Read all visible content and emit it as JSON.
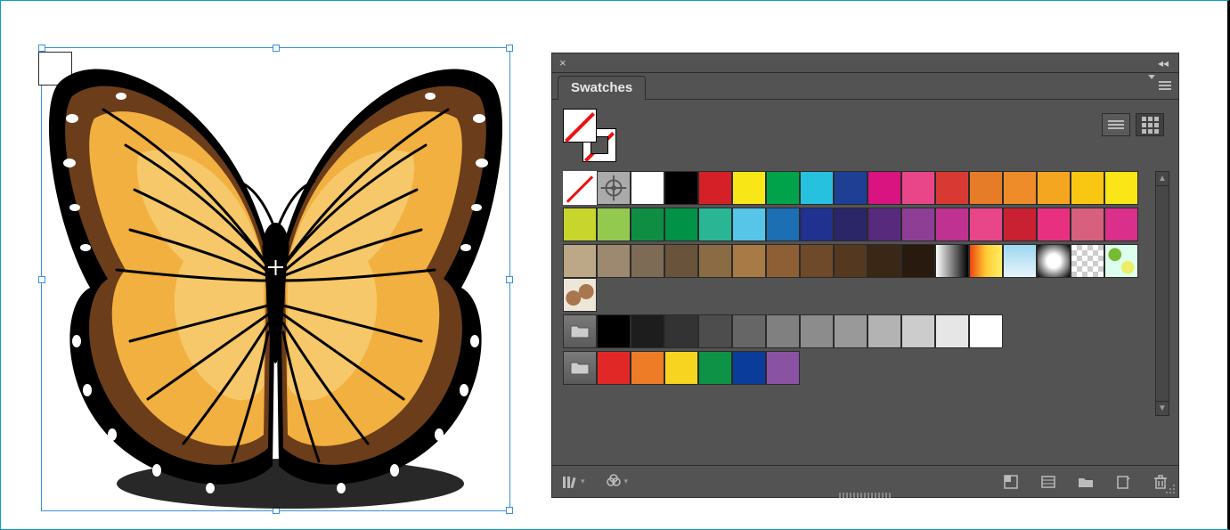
{
  "panel": {
    "tab_label": "Swatches",
    "view_mode": "grid"
  },
  "fill_stroke": {
    "fill": "none",
    "stroke": "none"
  },
  "view_buttons": {
    "list_tooltip": "List View",
    "grid_tooltip": "Thumbnail View"
  },
  "swatch_rows": {
    "row1": [
      {
        "name": "none",
        "kind": "none",
        "selected": true
      },
      {
        "name": "registration",
        "kind": "reg"
      },
      {
        "name": "white",
        "color": "#ffffff"
      },
      {
        "name": "black",
        "color": "#000000"
      },
      {
        "name": "red",
        "color": "#d62027"
      },
      {
        "name": "yellow",
        "color": "#f9e616"
      },
      {
        "name": "green",
        "color": "#00a34a"
      },
      {
        "name": "cyan",
        "color": "#27c1e0"
      },
      {
        "name": "blue",
        "color": "#1f3f94"
      },
      {
        "name": "magenta",
        "color": "#d9137f"
      },
      {
        "name": "rose",
        "color": "#e9468a"
      },
      {
        "name": "red2",
        "color": "#d83a33"
      },
      {
        "name": "orange",
        "color": "#e77c28"
      },
      {
        "name": "orange2",
        "color": "#ee8c2a"
      },
      {
        "name": "amber",
        "color": "#f4a620"
      },
      {
        "name": "gold",
        "color": "#f9c712"
      },
      {
        "name": "yellow2",
        "color": "#fae516"
      }
    ],
    "row2": [
      {
        "name": "chartreuse",
        "color": "#c7d52c"
      },
      {
        "name": "lime",
        "color": "#94c950"
      },
      {
        "name": "green2",
        "color": "#0f8e43"
      },
      {
        "name": "green3",
        "color": "#009247"
      },
      {
        "name": "teal",
        "color": "#2ab694"
      },
      {
        "name": "sky",
        "color": "#56c5e8"
      },
      {
        "name": "blue2",
        "color": "#1d6fb4"
      },
      {
        "name": "navy",
        "color": "#20318f"
      },
      {
        "name": "indigo",
        "color": "#2a2668"
      },
      {
        "name": "purple",
        "color": "#582a7e"
      },
      {
        "name": "violet",
        "color": "#8e3f95"
      },
      {
        "name": "fuchsia",
        "color": "#bf3291"
      },
      {
        "name": "pink",
        "color": "#e9468a"
      },
      {
        "name": "red3",
        "color": "#c92032"
      },
      {
        "name": "hotpink",
        "color": "#e73180"
      },
      {
        "name": "coral",
        "color": "#d6607e"
      },
      {
        "name": "magenta2",
        "color": "#da2f8a"
      }
    ],
    "row3": [
      {
        "name": "tan1",
        "color": "#bca786"
      },
      {
        "name": "tan2",
        "color": "#9d8970"
      },
      {
        "name": "brown1",
        "color": "#7e6b55"
      },
      {
        "name": "brown2",
        "color": "#6a533b"
      },
      {
        "name": "brown3",
        "color": "#8a6b44"
      },
      {
        "name": "brown4",
        "color": "#a87a45"
      },
      {
        "name": "brown5",
        "color": "#8e5f34"
      },
      {
        "name": "brown6",
        "color": "#6e4a2a"
      },
      {
        "name": "brown7",
        "color": "#54381f"
      },
      {
        "name": "brown8",
        "color": "#3b2716"
      },
      {
        "name": "brown9",
        "color": "#291a0f"
      },
      {
        "name": "grad-linear",
        "kind": "grad-linear"
      },
      {
        "name": "grad-warm",
        "kind": "grad-warm"
      },
      {
        "name": "grad-sky",
        "kind": "grad-sky"
      },
      {
        "name": "grad-radial",
        "kind": "grad-radial"
      },
      {
        "name": "checker",
        "kind": "checker"
      },
      {
        "name": "pattern-green",
        "kind": "pattern-green"
      },
      {
        "name": "pattern-swirl",
        "kind": "pattern-swirl"
      }
    ],
    "row4": [
      {
        "name": "folder-gray",
        "kind": "folder"
      },
      {
        "name": "black2",
        "color": "#000000"
      },
      {
        "name": "gray90",
        "color": "#1d1d1d"
      },
      {
        "name": "gray80",
        "color": "#333333"
      },
      {
        "name": "gray70",
        "color": "#4d4d4d"
      },
      {
        "name": "gray60",
        "color": "#666666"
      },
      {
        "name": "gray50",
        "color": "#808080"
      },
      {
        "name": "gray45",
        "color": "#8c8c8c"
      },
      {
        "name": "gray40",
        "color": "#999999"
      },
      {
        "name": "gray30",
        "color": "#b3b3b3"
      },
      {
        "name": "gray20",
        "color": "#cccccc"
      },
      {
        "name": "gray10",
        "color": "#e6e6e6"
      },
      {
        "name": "white2",
        "color": "#ffffff"
      }
    ],
    "row5": [
      {
        "name": "folder-bright",
        "kind": "folder"
      },
      {
        "name": "br-red",
        "color": "#e22727"
      },
      {
        "name": "br-orange",
        "color": "#ee7b26"
      },
      {
        "name": "br-yellow",
        "color": "#f6d41f"
      },
      {
        "name": "br-green",
        "color": "#0d9246"
      },
      {
        "name": "br-blue",
        "color": "#0a3d9b"
      },
      {
        "name": "br-violet",
        "color": "#8a52a3"
      }
    ]
  },
  "footer_icons": {
    "libraries": "Swatch Libraries",
    "kinds": "Show Swatch Kinds",
    "options": "Swatch Options",
    "group": "New Color Group",
    "new": "New Swatch",
    "delete": "Delete Swatch"
  },
  "artwork": {
    "label": "butterfly-illustration",
    "colors": {
      "wing_base": "#f2b040",
      "wing_highlight": "#f6c86a",
      "outline": "#000",
      "border": "#6b3d1a",
      "body": "#000"
    }
  }
}
